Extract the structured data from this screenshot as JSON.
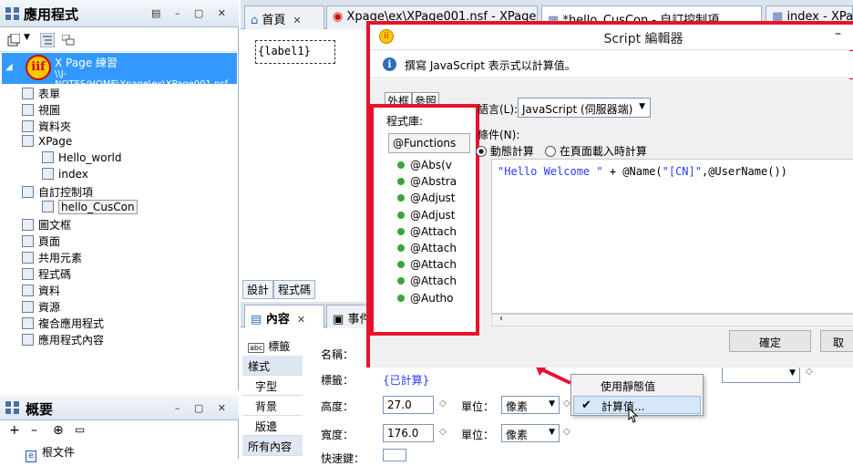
{
  "app_panel": {
    "title": "應用程式"
  },
  "app": {
    "name": "X Page 練習",
    "path": "\\\\J-NOTES/HOME\\Xpage\\ex\\XPage001.nsf",
    "logo_text": "iif"
  },
  "tree": [
    {
      "label": "表單",
      "indent": 1
    },
    {
      "label": "視圖",
      "indent": 1
    },
    {
      "label": "資料夾",
      "indent": 1
    },
    {
      "label": "XPage",
      "indent": 1
    },
    {
      "label": "Hello_world",
      "indent": 2
    },
    {
      "label": "index",
      "indent": 2
    },
    {
      "label": "自訂控制項",
      "indent": 1
    },
    {
      "label": "hello_CusCon",
      "indent": 2
    },
    {
      "label": "圖文框",
      "indent": 1
    },
    {
      "label": "頁面",
      "indent": 1
    },
    {
      "label": "共用元素",
      "indent": 1
    },
    {
      "label": "程式碼",
      "indent": 1
    },
    {
      "label": "資料",
      "indent": 1
    },
    {
      "label": "資源",
      "indent": 1
    },
    {
      "label": "複合應用程式",
      "indent": 1
    },
    {
      "label": "應用程式內容",
      "indent": 1
    }
  ],
  "overview_panel": {
    "title": "概要",
    "item": "根文件"
  },
  "tabs": [
    {
      "label": "首頁"
    },
    {
      "label": "Xpage\\ex\\XPage001.nsf - XPage"
    },
    {
      "label": "*hello_CusCon - 自訂控制項"
    },
    {
      "label": "index - XPage"
    }
  ],
  "canvas": {
    "label": "{label1}"
  },
  "design_tabs": {
    "design": "設計",
    "source": "程式碼"
  },
  "props": {
    "tab_content": "內容",
    "tab_events": "事件",
    "side_top": "標籤",
    "side": [
      "樣式",
      "字型",
      "背景",
      "版邊",
      "所有內容"
    ],
    "name_label": "名稱：",
    "label_label": "標籤：",
    "label_value": "{已計算}",
    "height_label": "高度：",
    "height_value": "27.0",
    "width_label": "寬度：",
    "width_value": "176.0",
    "unit_label": "單位：",
    "unit_value": "像素",
    "partial_label": "快速鍵："
  },
  "context_menu": {
    "items": [
      "使用靜態值",
      "計算值..."
    ]
  },
  "dialog": {
    "title": "Script 編輯器",
    "info": "撰寫 JavaScript 表示式以計算值。",
    "tab_outline": "外框",
    "tab_reference": "參照",
    "library_label": "程式庫:",
    "library_value": "@Functions",
    "functions": [
      "@Abs(v",
      "@Abstra",
      "@Adjust",
      "@Adjust",
      "@Attach",
      "@Attach",
      "@Attach",
      "@Attach",
      "@Autho"
    ],
    "language_label": "語言(L):",
    "language_value": "JavaScript (伺服器端)",
    "condition_label": "條件(N):",
    "radio_dynamic": "動態計算",
    "radio_onload": "在頁面載入時計算",
    "code_part1": "\"Hello Welcome \"",
    "code_part2": " + @Name(",
    "code_part3": "\"[CN]\"",
    "code_part4": ",@UserName())",
    "ok": "確定",
    "cancel": "取"
  }
}
